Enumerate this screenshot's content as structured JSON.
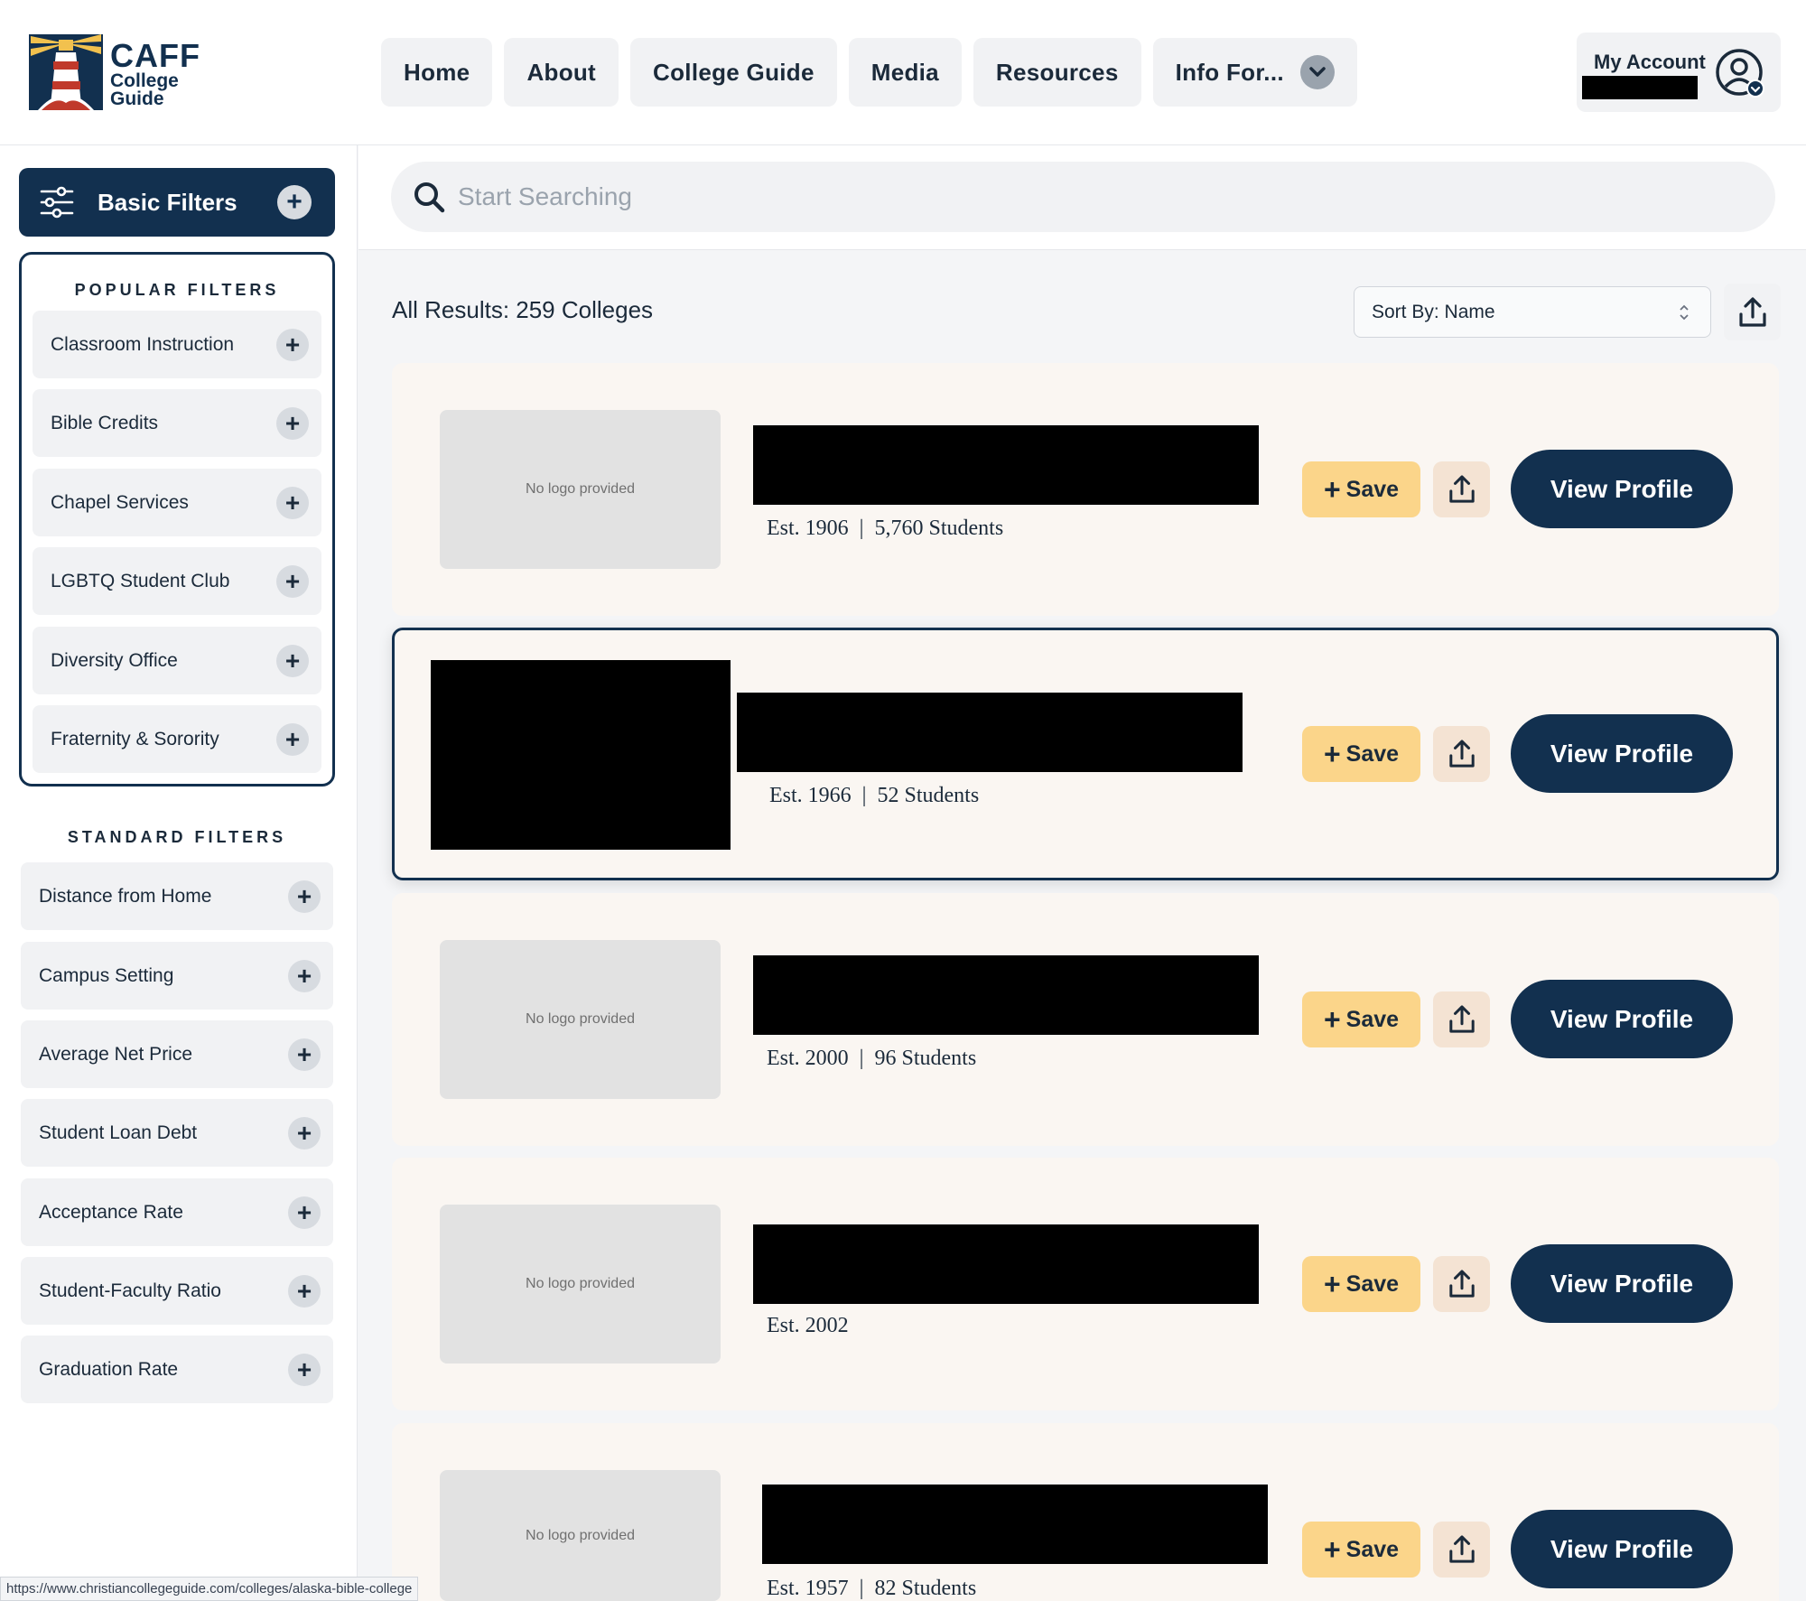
{
  "header": {
    "logo": {
      "name": "CAFF",
      "sub1": "College",
      "sub2": "Guide"
    },
    "nav": [
      {
        "label": "Home"
      },
      {
        "label": "About"
      },
      {
        "label": "College Guide"
      },
      {
        "label": "Media"
      },
      {
        "label": "Resources"
      },
      {
        "label": "Info For..."
      }
    ],
    "account_label": "My Account"
  },
  "sidebar": {
    "basic_filters_label": "Basic Filters",
    "popular_title": "POPULAR FILTERS",
    "popular": [
      "Classroom Instruction",
      "Bible Credits",
      "Chapel Services",
      "LGBTQ Student Club",
      "Diversity Office",
      "Fraternity & Sorority"
    ],
    "standard_title": "STANDARD FILTERS",
    "standard": [
      "Distance from Home",
      "Campus Setting",
      "Average Net Price",
      "Student Loan Debt",
      "Acceptance Rate",
      "Student-Faculty Ratio",
      "Graduation Rate"
    ]
  },
  "search": {
    "placeholder": "Start Searching",
    "value": ""
  },
  "results": {
    "count_label": "All Results: 259 Colleges",
    "sort_label": "Sort By: Name",
    "no_logo_text": "No logo provided",
    "save_label": "Save",
    "view_profile_label": "View Profile",
    "separator": "|",
    "cards": [
      {
        "est": "Est. 1906",
        "students": "5,760 Students"
      },
      {
        "est": "Est. 1966",
        "students": "52 Students"
      },
      {
        "est": "Est. 2000",
        "students": "96 Students"
      },
      {
        "est": "Est. 2002",
        "students": ""
      },
      {
        "est": "Est. 1957",
        "students": "82 Students"
      }
    ]
  },
  "status_url": "https://www.christiancollegeguide.com/colleges/alaska-bible-college",
  "colors": {
    "navy": "#12304f",
    "save": "#fbd58a",
    "card_bg": "#faf6f2"
  }
}
